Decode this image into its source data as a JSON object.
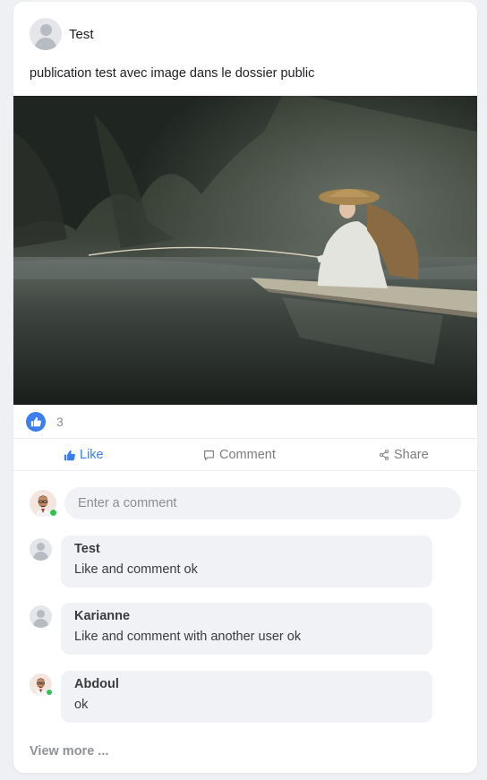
{
  "post": {
    "author": "Test",
    "text": "publication test avec image dans le dossier public",
    "image_alt": "Person in straw hat fishing on a bamboo raft",
    "reaction_count": "3",
    "actions": {
      "like": "Like",
      "comment": "Comment",
      "share": "Share"
    }
  },
  "comment_box": {
    "placeholder": "Enter a comment"
  },
  "comments": [
    {
      "author": "Test",
      "text": "Like and comment ok"
    },
    {
      "author": "Karianne",
      "text": "Like and comment with another user ok"
    },
    {
      "author": "Abdoul",
      "text": "ok"
    }
  ],
  "view_more": "View more ...",
  "colors": {
    "accent": "#3b7ef0",
    "online": "#31c34f",
    "bubble": "#f0f2f5"
  }
}
